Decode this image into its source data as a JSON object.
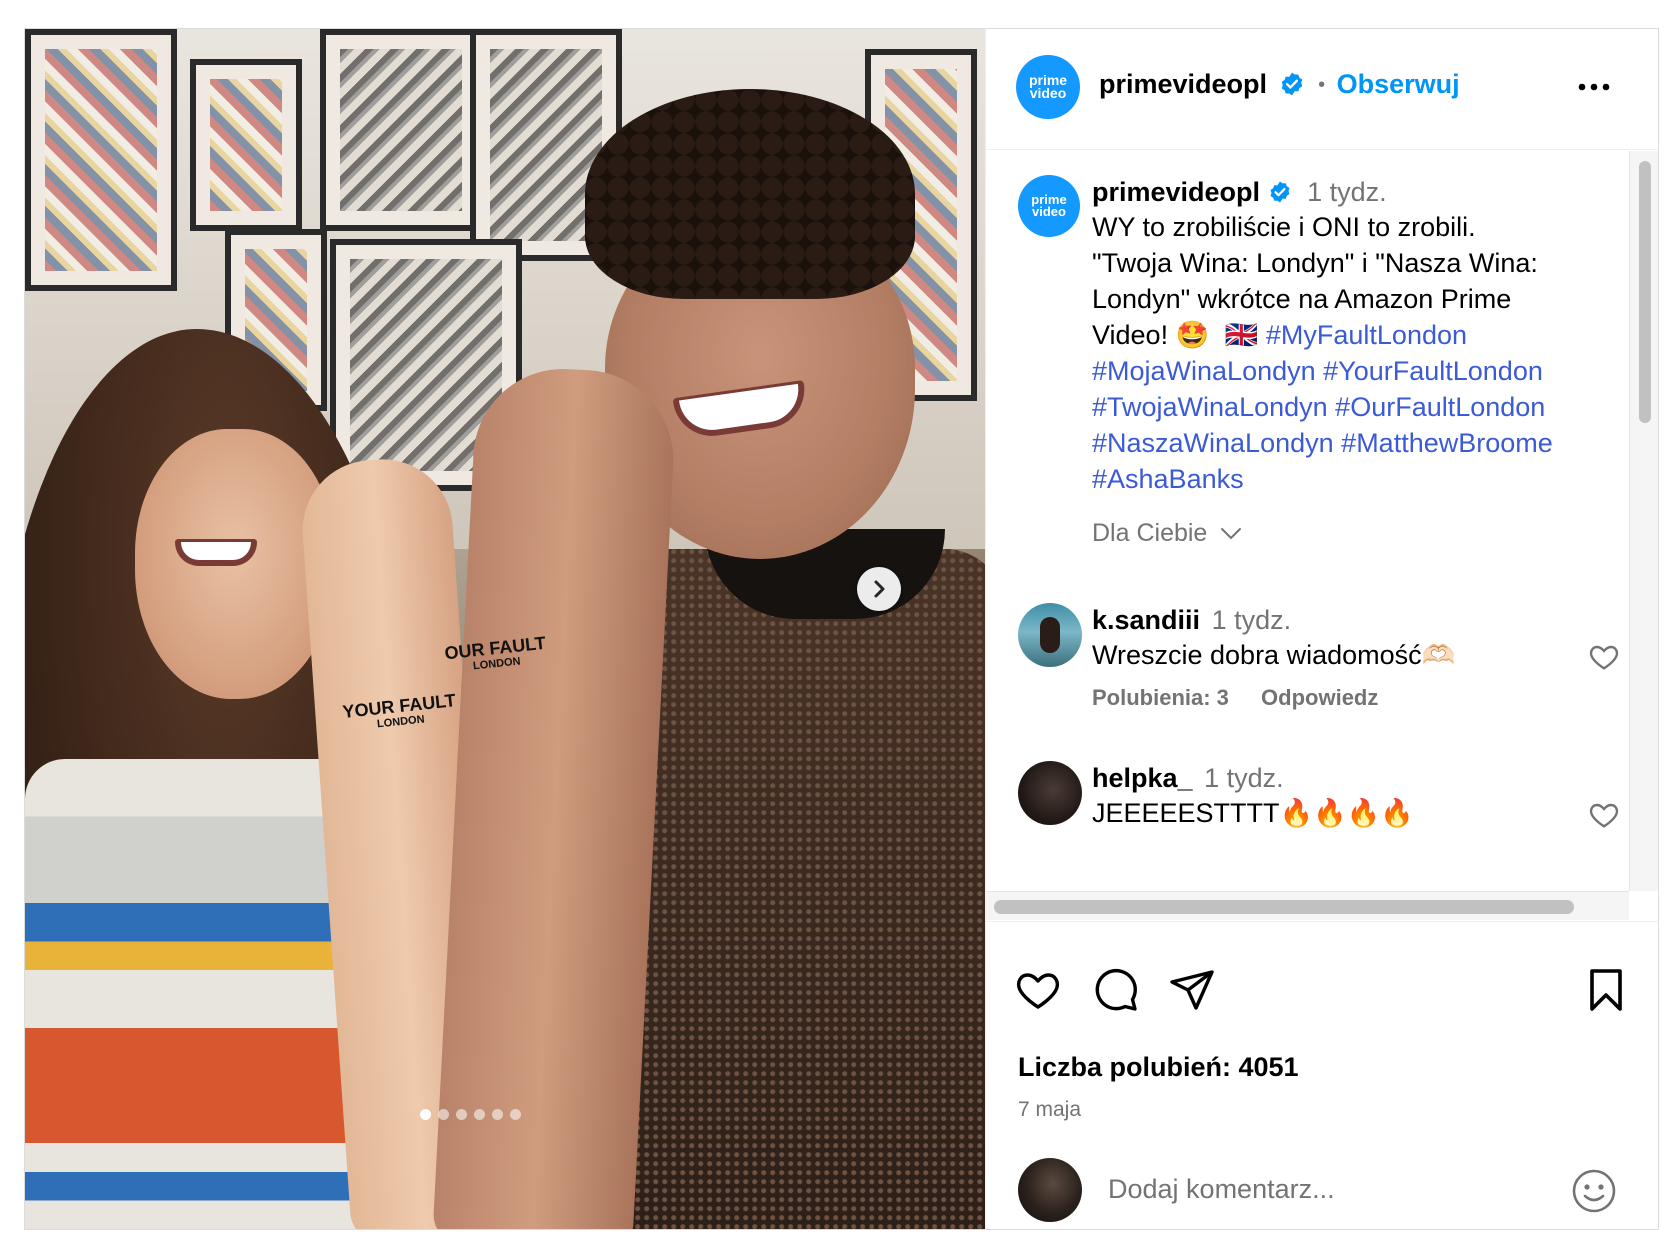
{
  "account": {
    "username": "primevideopl",
    "avatar_line1": "prime",
    "avatar_line2": "video",
    "separator": "•",
    "follow_label": "Obserwuj"
  },
  "caption": {
    "username": "primevideopl",
    "time": "1 tydz.",
    "line1": "WY to zrobiliście i ONI to zrobili.",
    "line2": "\"Twoja Wina: Londyn\" i \"Nasza Wina:",
    "line3": "Londyn\" wkrótce na Amazon Prime",
    "line4_text": "Video!",
    "emoji_star": "🤩",
    "emoji_flag": "🇬🇧",
    "hashtags": [
      "#MyFaultLondon",
      "#MojaWinaLondyn",
      "#YourFaultLondon",
      "#TwojaWinaLondyn",
      "#OurFaultLondon",
      "#NaszaWinaLondyn",
      "#MatthewBroome",
      "#AshaBanks"
    ]
  },
  "filter": {
    "label": "Dla Ciebie"
  },
  "comments": [
    {
      "username": "k.sandiii",
      "time": "1 tydz.",
      "text": "Wreszcie dobra wiadomość🫶🏻",
      "likes_label": "Polubienia: 3",
      "reply_label": "Odpowiedz"
    },
    {
      "username": "helpka_",
      "time": "1 tydz.",
      "text": "JEEEEESTTTT🔥🔥🔥🔥"
    }
  ],
  "footer": {
    "likes_label": "Liczba polubień: 4051",
    "date": "7 maja",
    "add_comment_placeholder": "Dodaj komentarz..."
  },
  "media": {
    "tattoo_left_big": "YOUR FAULT",
    "tattoo_left_small": "LONDON",
    "tattoo_right_big": "OUR FAULT",
    "tattoo_right_small": "LONDON",
    "carousel_slide": 1,
    "carousel_total": 6
  },
  "colors": {
    "accent_follow": "#0095f6",
    "hashtag": "#3b5ad6",
    "verified": "#0095f6",
    "prime_blue": "#1399ff"
  }
}
